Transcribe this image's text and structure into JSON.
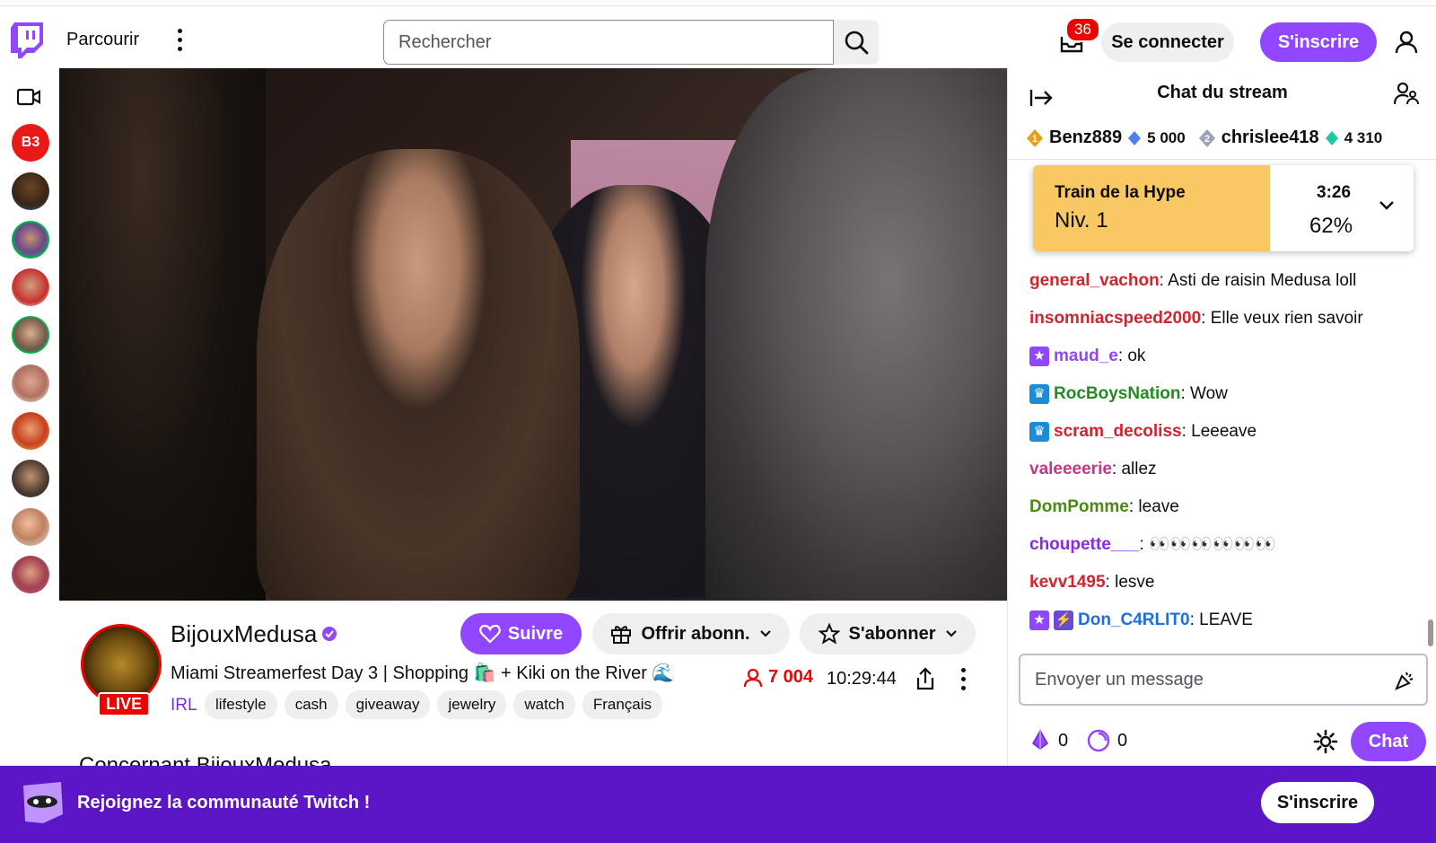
{
  "topbar": {
    "browse_label": "Parcourir",
    "search_placeholder": "Rechercher",
    "inbox_count": "36",
    "login_label": "Se connecter",
    "signup_label": "S'inscrire"
  },
  "rail": {
    "channels": [
      "channel-1",
      "channel-2",
      "channel-3",
      "channel-4",
      "channel-5",
      "channel-6",
      "channel-7",
      "channel-8",
      "channel-9",
      "channel-10"
    ]
  },
  "stream": {
    "streamer_name": "BijouxMedusa",
    "live_label": "LIVE",
    "title": "Miami Streamerfest Day 3 | Shopping 🛍️ + Kiki on the River 🌊",
    "category": "IRL",
    "tags": [
      "lifestyle",
      "cash",
      "giveaway",
      "jewelry",
      "watch",
      "Français"
    ],
    "follow_label": "Suivre",
    "gift_label": "Offrir abonn.",
    "subscribe_label": "S'abonner",
    "viewers": "7 004",
    "uptime": "10:29:44",
    "about_label": "Concernant BijouxMedusa"
  },
  "chat": {
    "title": "Chat du stream",
    "leaderboard": [
      {
        "rank": "1",
        "name": "Benz889",
        "points": "5 000"
      },
      {
        "rank": "2",
        "name": "chrislee418",
        "points": "4 310"
      }
    ],
    "hype": {
      "label": "Train de la Hype",
      "level": "Niv. 1",
      "time": "3:26",
      "percent": "62%",
      "percent_value": 62
    },
    "messages": [
      {
        "user": "general_vachon",
        "text": ": Asti de raisin Medusa loll",
        "color": "#d1242f",
        "badges": []
      },
      {
        "user": "insomniacspeed2000",
        "text": ": Elle veux rien savoir",
        "color": "#d1242f",
        "badges": []
      },
      {
        "user": "maud_e",
        "text": ": ok",
        "color": "#9147ff",
        "badges": [
          "star"
        ]
      },
      {
        "user": "RocBoysNation",
        "text": ": Wow",
        "color": "#228b22",
        "badges": [
          "crown"
        ]
      },
      {
        "user": "scram_decoliss",
        "text": ": Leeeave",
        "color": "#d1242f",
        "badges": [
          "crown"
        ]
      },
      {
        "user": "valeeeerie",
        "text": ": allez",
        "color": "#c0398a",
        "badges": []
      },
      {
        "user": "DomPomme",
        "text": ": leave",
        "color": "#4a8a10",
        "badges": []
      },
      {
        "user": "choupette___",
        "text": ": 👀👀👀👀👀👀",
        "color": "#8a2be2",
        "badges": []
      },
      {
        "user": "kevv1495",
        "text": ": lesve",
        "color": "#d1242f",
        "badges": []
      },
      {
        "user": "Don_C4RLIT0",
        "text": ": LEAVE",
        "color": "#1e6fd9",
        "badges": [
          "star",
          "bolt"
        ]
      }
    ],
    "input_placeholder": "Envoyer un message",
    "bits_count": "0",
    "points_count": "0",
    "chat_button_label": "Chat"
  },
  "banner": {
    "text": "Rejoignez la communauté Twitch !",
    "button_label": "S'inscrire"
  },
  "colors": {
    "brand": "#9147ff",
    "banner": "#5c16c5",
    "live": "#eb0400",
    "hype": "#fac862"
  }
}
